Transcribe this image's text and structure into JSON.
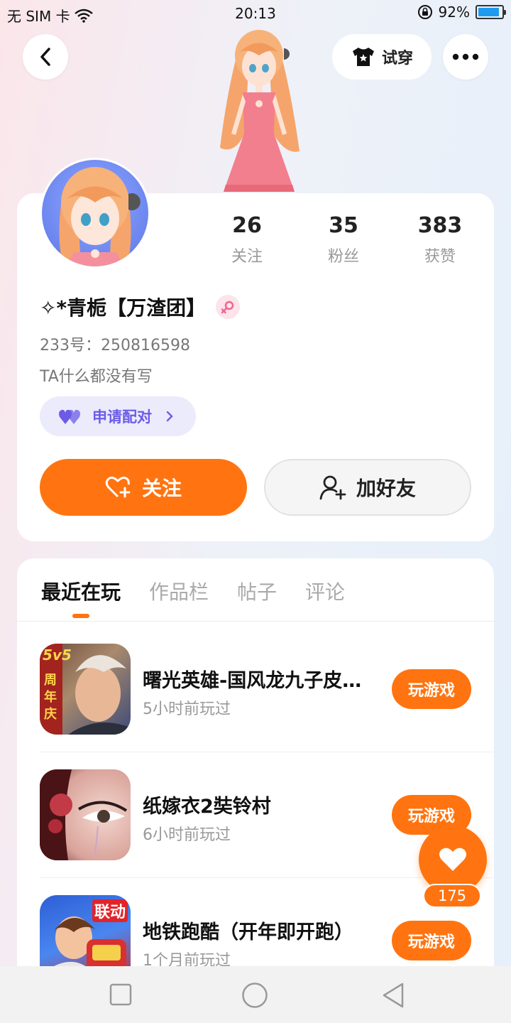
{
  "status_bar": {
    "carrier": "无 SIM 卡",
    "time": "20:13",
    "battery_percent": "92%",
    "battery_level": 0.92,
    "icons": [
      "wifi-icon",
      "rotation-lock-icon",
      "battery-icon"
    ]
  },
  "header": {
    "back_icon": "chevron-left-icon",
    "tryon_label": "试穿",
    "more_icon": "more-dots-icon"
  },
  "profile": {
    "stats": [
      {
        "num": "26",
        "label": "关注"
      },
      {
        "num": "35",
        "label": "粉丝"
      },
      {
        "num": "383",
        "label": "获赞"
      }
    ],
    "username": "✧*青栀【万渣团】",
    "gender": "female",
    "uid": "233号：250816598",
    "bio": "TA什么都没有写",
    "pair_label": "申请配对",
    "follow_label": "关注",
    "add_friend_label": "加好友"
  },
  "tabs": [
    {
      "label": "最近在玩",
      "active": true
    },
    {
      "label": "作品栏",
      "active": false
    },
    {
      "label": "帖子",
      "active": false
    },
    {
      "label": "评论",
      "active": false
    }
  ],
  "games": [
    {
      "title": "曙光英雄-国风龙九子皮肤上线",
      "time": "5小时前玩过",
      "play_label": "玩游戏",
      "icon_text": [
        "5v5",
        "周",
        "年",
        "庆"
      ]
    },
    {
      "title": "纸嫁衣2奘铃村",
      "time": "6小时前玩过",
      "play_label": "玩游戏"
    },
    {
      "title": "地铁跑酷（开年即开跑）",
      "time": "1个月前玩过",
      "play_label": "玩游戏",
      "icon_text": [
        "联动"
      ]
    }
  ],
  "like_fab": {
    "count": "175"
  },
  "colors": {
    "accent": "#ff7410",
    "pair": "#6b5ce7",
    "pair_bg": "#ecebfc"
  }
}
